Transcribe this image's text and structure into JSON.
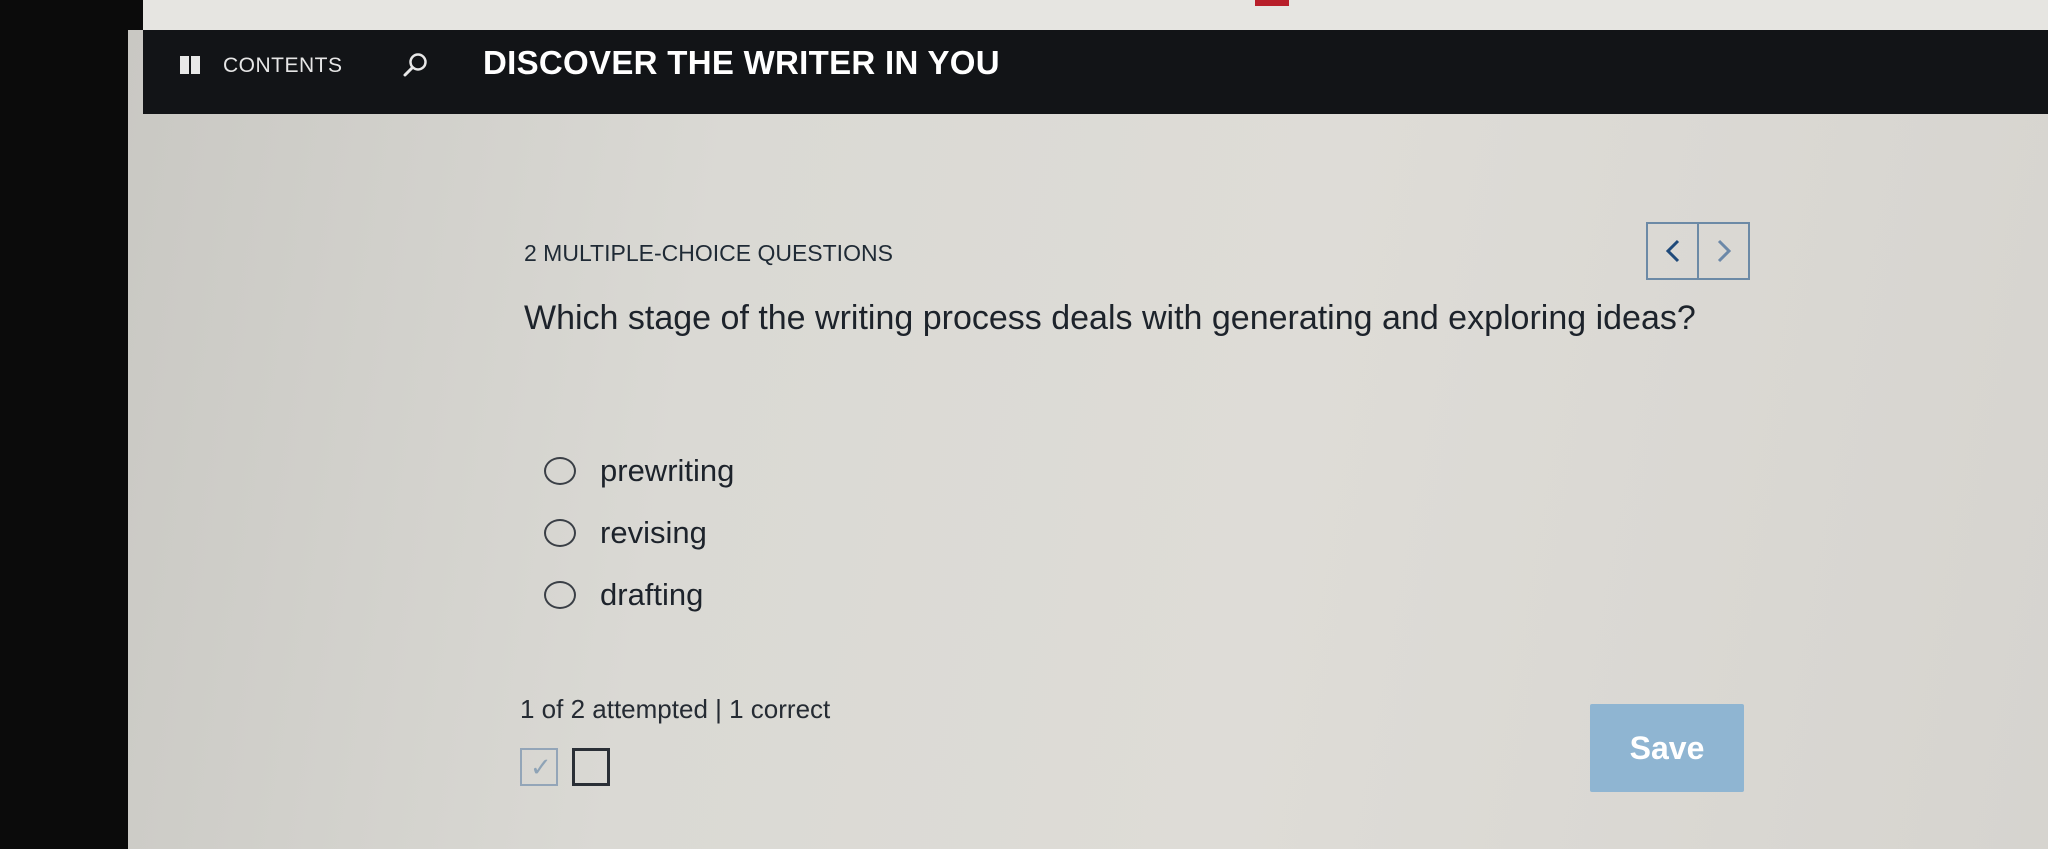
{
  "header": {
    "contents_label": "CONTENTS",
    "title": "DISCOVER THE WRITER IN YOU"
  },
  "quiz": {
    "section_label": "2 MULTIPLE-CHOICE QUESTIONS",
    "question": "Which stage of the writing process deals with generating and exploring ideas?",
    "options": [
      {
        "label": "prewriting",
        "selected": false
      },
      {
        "label": "revising",
        "selected": false
      },
      {
        "label": "drafting",
        "selected": false
      }
    ],
    "status": "1 of 2 attempted | 1 correct",
    "save_label": "Save",
    "questions": [
      {
        "state": "answered-correct"
      },
      {
        "state": "unanswered"
      }
    ]
  },
  "icons": {
    "book": "book-icon",
    "search": "search-icon",
    "prev": "chevron-left-icon",
    "next": "chevron-right-icon",
    "check": "check-icon"
  },
  "colors": {
    "header_bg": "#121417",
    "save_bg": "#8fb5d2",
    "nav_border": "#6c8aa6",
    "text": "#1d232b"
  }
}
